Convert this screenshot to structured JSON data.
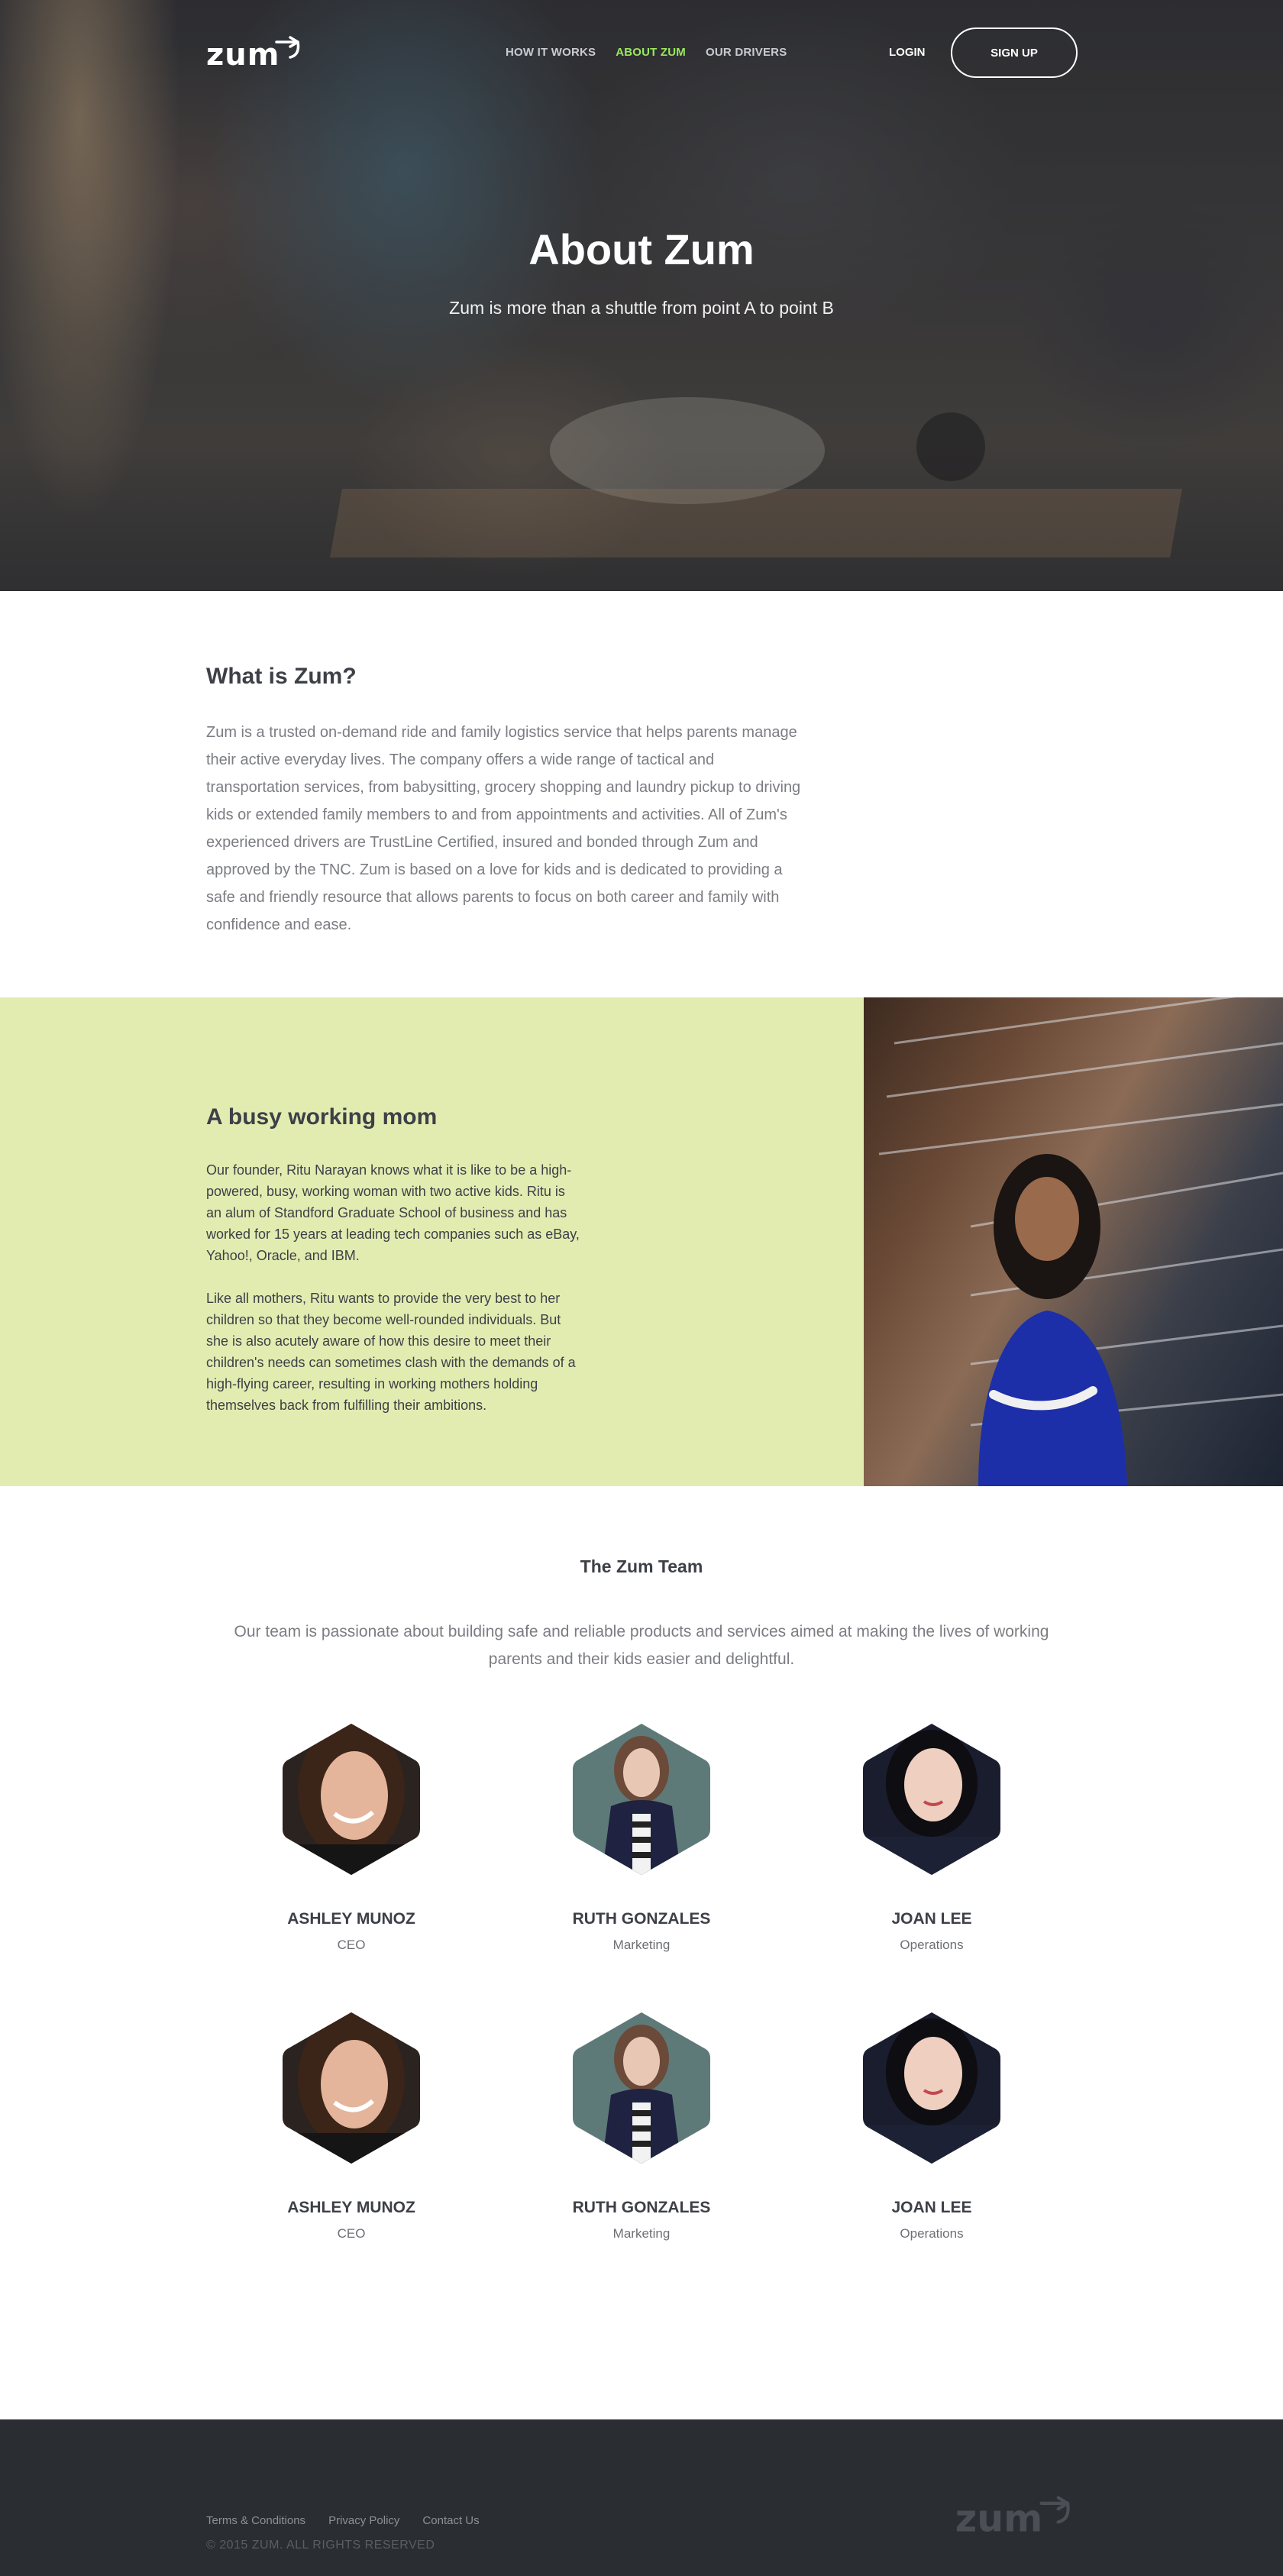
{
  "nav": {
    "logo": "zum",
    "links": [
      "HOW IT WORKS",
      "ABOUT ZUM",
      "OUR DRIVERS"
    ],
    "active_index": 1,
    "login": "LOGIN",
    "signup": "SIGN UP"
  },
  "hero": {
    "title": "About Zum",
    "subtitle": "Zum is more than a shuttle from point A to point B"
  },
  "what": {
    "heading": "What is Zum?",
    "body": "Zum is a trusted on-demand ride and family logistics service that helps parents manage their active everyday lives. The company offers a wide range of tactical and transportation services, from babysitting, grocery shopping and laundry pickup to driving kids or extended family members to and from appointments and activities. All of Zum's experienced drivers are TrustLine Certified, insured and bonded through Zum and approved by the TNC. Zum is based on a love for kids and is dedicated to providing a safe and friendly resource that allows parents to focus on both career and family with confidence and ease."
  },
  "mom": {
    "heading": "A busy working mom",
    "p1": "Our founder, Ritu Narayan knows what it is like to be a high-powered, busy, working woman with two active kids. Ritu is an alum of Standford Graduate School of business and has worked for 15 years at leading tech companies such as eBay, Yahoo!, Oracle, and IBM.",
    "p2": "Like all mothers, Ritu wants to provide the very best to her children so that they become well-rounded individuals. But she is also acutely aware of how this desire to meet their children's needs can sometimes clash with the demands of a high-flying career, resulting in working mothers holding themselves back from fulfilling their ambitions."
  },
  "team": {
    "heading": "The Zum Team",
    "intro": "Our team is passionate about building safe and reliable products and services aimed at making the lives of working parents and their kids easier and delightful.",
    "members": [
      {
        "name": "ASHLEY MUNOZ",
        "role": "CEO"
      },
      {
        "name": "RUTH GONZALES",
        "role": "Marketing"
      },
      {
        "name": "JOAN LEE",
        "role": "Operations"
      },
      {
        "name": "ASHLEY MUNOZ",
        "role": "CEO"
      },
      {
        "name": "RUTH GONZALES",
        "role": "Marketing"
      },
      {
        "name": "JOAN LEE",
        "role": "Operations"
      }
    ]
  },
  "footer": {
    "links": [
      "Terms & Conditions",
      "Privacy Policy",
      "Contact Us"
    ],
    "copyright": "© 2015 ZUM. ALL RIGHTS RESERVED",
    "logo": "zum"
  },
  "colors": {
    "accent_green": "#9ae85d",
    "mom_bg": "#e2ecb1",
    "footer_bg": "#2a2d32",
    "text_dark": "#3d4047",
    "text_muted": "#7b7d82"
  }
}
